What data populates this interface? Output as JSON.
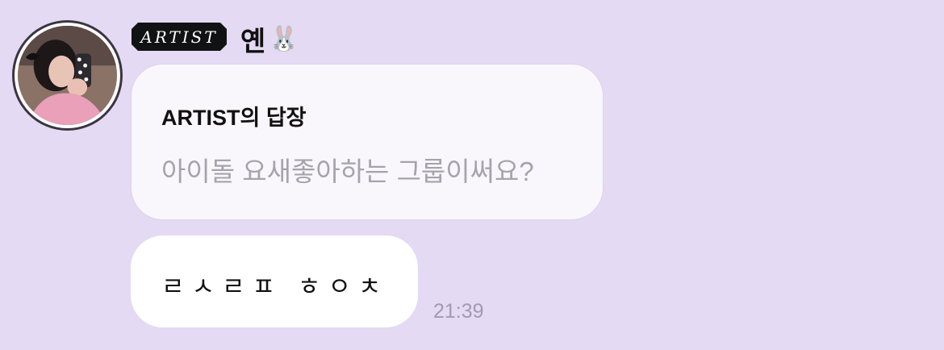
{
  "sender": {
    "badge": "ARTIST",
    "name": "옌",
    "name_emoji": "🐰"
  },
  "reply": {
    "title": "ARTIST의 답장",
    "quoted_text": "아이돌 요새좋아하는 그룹이써요?"
  },
  "message": {
    "text": "ㄹㅅㄹㅍ ㅎㅇㅊ",
    "time": "21:39"
  }
}
